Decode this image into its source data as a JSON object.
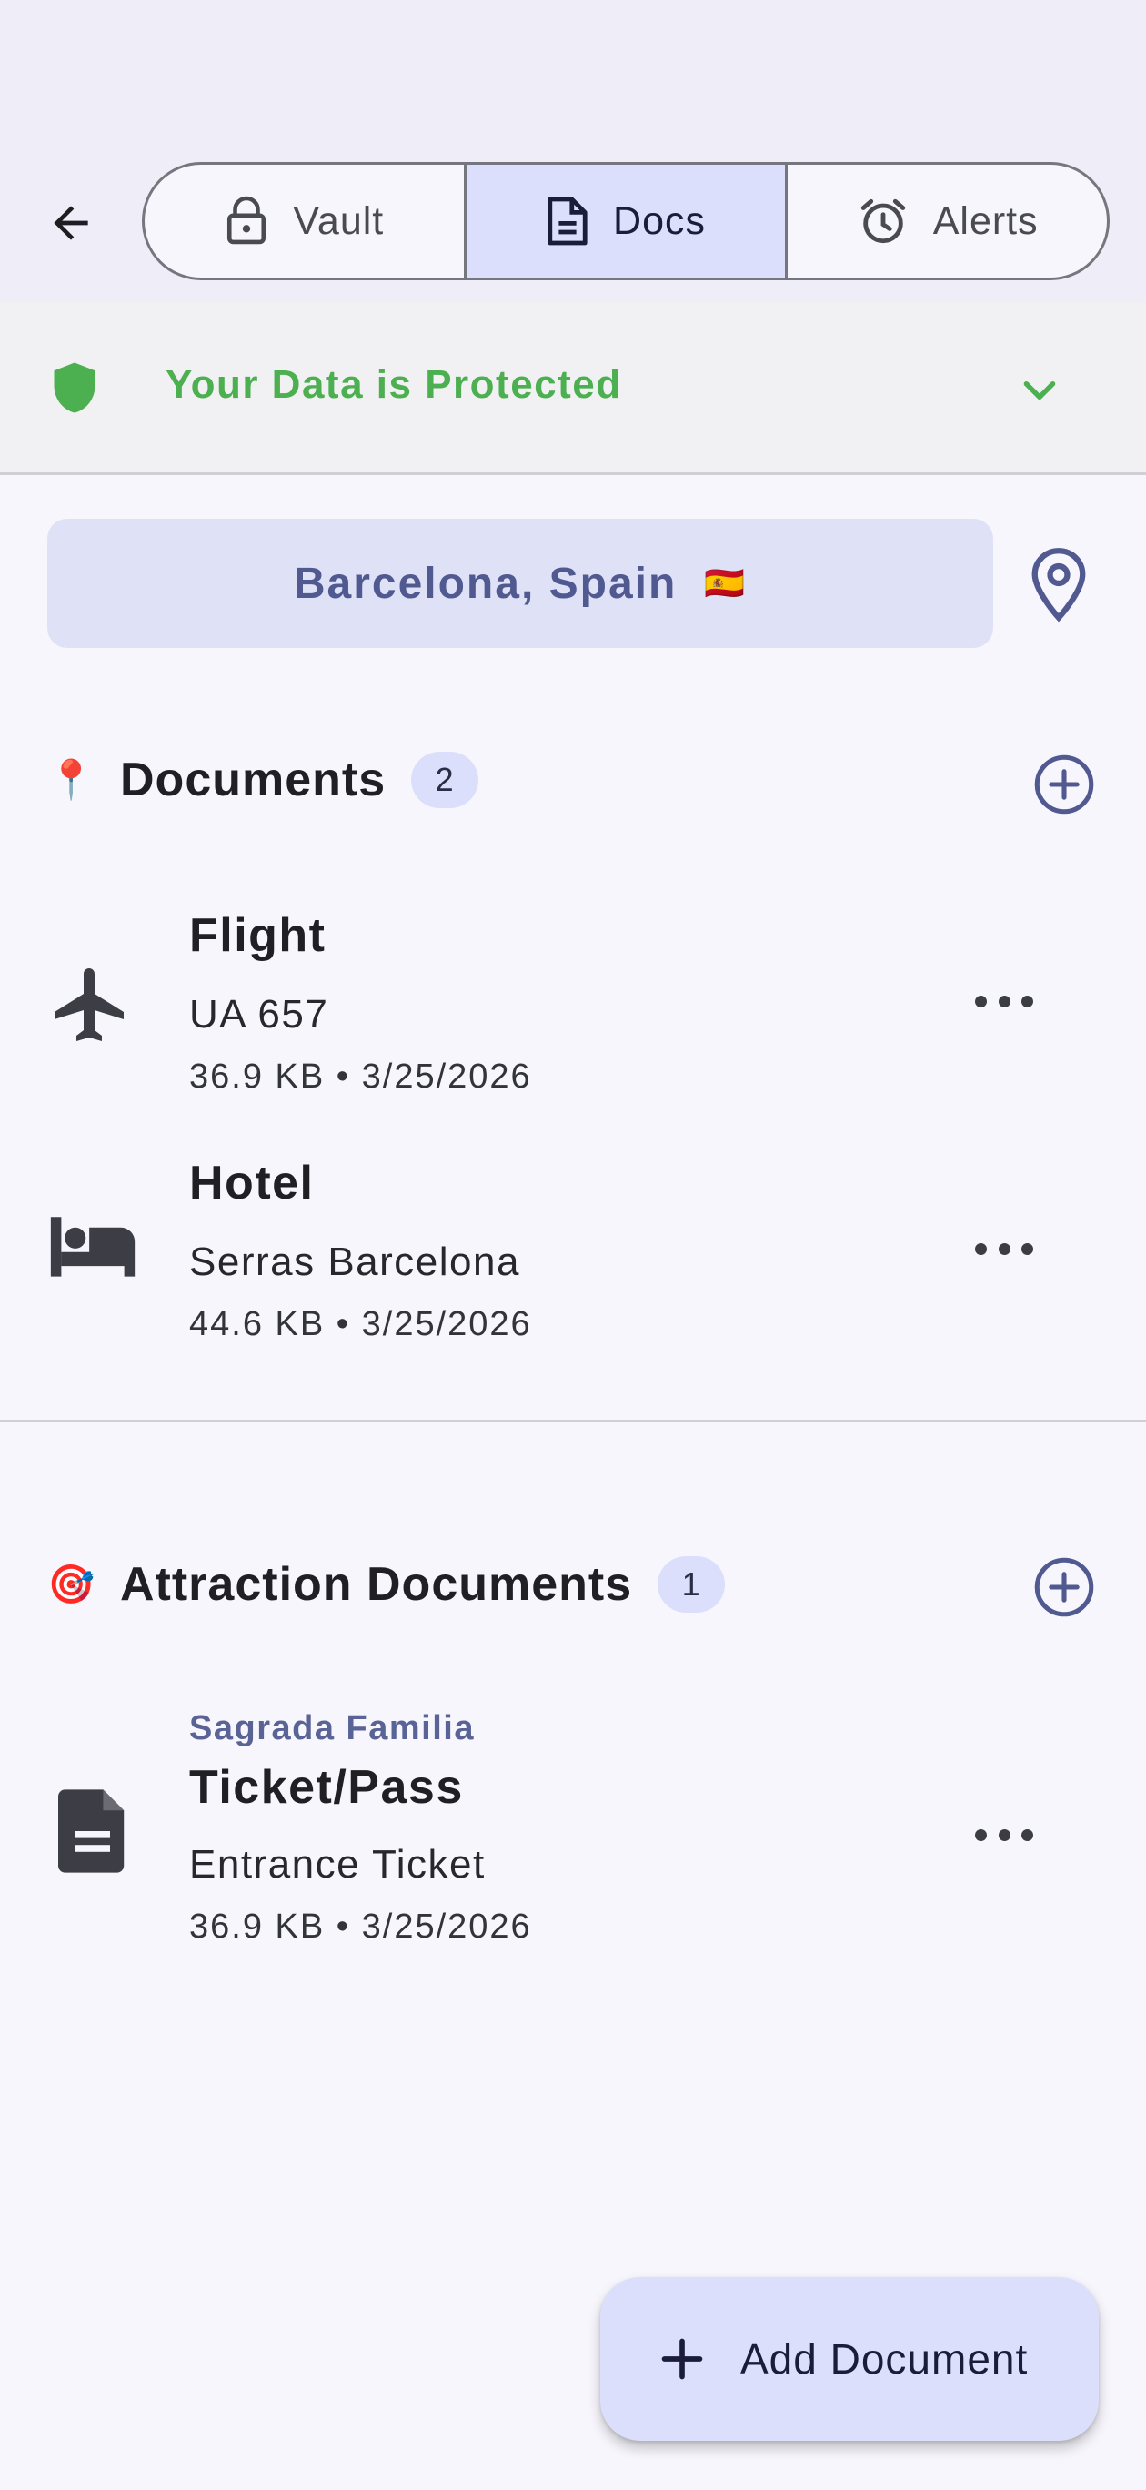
{
  "tabs": [
    {
      "label": "Vault",
      "icon": "lock-icon",
      "active": false
    },
    {
      "label": "Docs",
      "icon": "document-icon",
      "active": true
    },
    {
      "label": "Alerts",
      "icon": "alarm-icon",
      "active": false
    }
  ],
  "protection": {
    "text": "Your Data is Protected",
    "color": "#4caf50"
  },
  "location": {
    "name": "Barcelona, Spain",
    "flag": "🇪🇸"
  },
  "sections": {
    "documents": {
      "emoji": "📍",
      "title": "Documents",
      "count": "2",
      "items": [
        {
          "icon": "airplane-icon",
          "title": "Flight",
          "subtitle": "UA 657",
          "meta": "36.9 KB • 3/25/2026"
        },
        {
          "icon": "bed-icon",
          "title": "Hotel",
          "subtitle": "Serras Barcelona",
          "meta": "44.6 KB • 3/25/2026"
        }
      ]
    },
    "attractions": {
      "emoji": "🎯",
      "title": "Attraction Documents",
      "count": "1",
      "items": [
        {
          "icon": "document-icon",
          "topline": "Sagrada Familia",
          "title": "Ticket/Pass",
          "subtitle": "Entrance Ticket",
          "meta": "36.9 KB • 3/25/2026"
        }
      ]
    }
  },
  "fab": {
    "label": "Add Document"
  },
  "colors": {
    "accent": "#515a90",
    "accent_bg": "#dcdffb",
    "success": "#4caf50"
  }
}
